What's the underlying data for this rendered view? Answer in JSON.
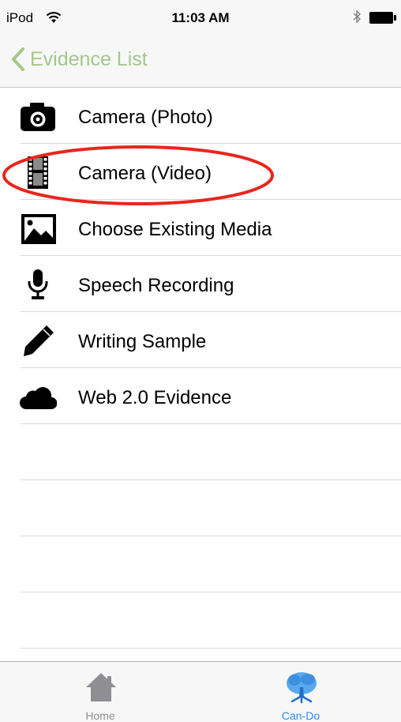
{
  "status_bar": {
    "carrier": "iPod",
    "time": "11:03 AM",
    "wifi_icon": "wifi-icon",
    "bluetooth_icon": "bluetooth-icon",
    "battery_icon": "battery-icon"
  },
  "nav": {
    "back_label": "Evidence List",
    "back_icon": "chevron-left-icon",
    "accent": "#a4c88a"
  },
  "options": [
    {
      "label": "Camera (Photo)",
      "icon": "camera-icon"
    },
    {
      "label": "Camera (Video)",
      "icon": "film-strip-icon",
      "circled": true
    },
    {
      "label": "Choose Existing Media",
      "icon": "image-icon"
    },
    {
      "label": "Speech Recording",
      "icon": "microphone-icon"
    },
    {
      "label": "Writing Sample",
      "icon": "pencil-icon"
    },
    {
      "label": "Web 2.0 Evidence",
      "icon": "cloud-icon"
    }
  ],
  "annotation": {
    "color": "#e8261c",
    "shape": "ellipse",
    "target": "Camera (Video)"
  },
  "tab_bar": {
    "tabs": [
      {
        "label": "Home",
        "icon": "house-icon",
        "color": "#8e8e93"
      },
      {
        "label": "Can-Do",
        "icon": "tree-icon",
        "color": "#2f8ce8",
        "selected": true
      }
    ]
  }
}
